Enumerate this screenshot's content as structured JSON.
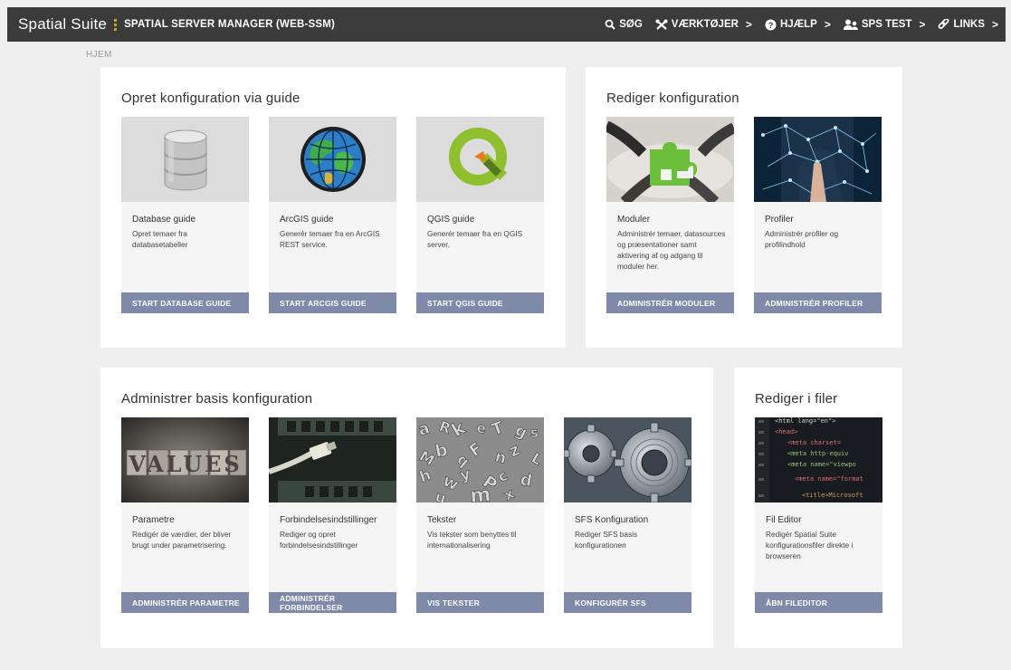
{
  "header": {
    "brand_name": "Spatial Suite",
    "brand_sub": "SPATIAL SERVER MANAGER (WEB-SSM)",
    "nav": [
      {
        "label": "SØG",
        "icon": "search-icon"
      },
      {
        "label": "VÆRKTØJER",
        "icon": "tools-icon"
      },
      {
        "label": "HJÆLP",
        "icon": "help-icon"
      },
      {
        "label": "SPS TEST",
        "icon": "users-icon"
      },
      {
        "label": "LINKS",
        "icon": "link-icon"
      }
    ],
    "caret": ">"
  },
  "breadcrumb": "HJEM",
  "panels": [
    {
      "title": "Opret konfiguration via guide",
      "cards": [
        {
          "title": "Database guide",
          "desc": "Opret temaer fra databasetabeller",
          "button": "START DATABASE GUIDE",
          "image": "database-image"
        },
        {
          "title": "ArcGIS guide",
          "desc": "Generér temaer fra en ArcGIS REST service.",
          "button": "START ARCGIS GUIDE",
          "image": "arcgis-globe-image"
        },
        {
          "title": "QGIS guide",
          "desc": "Generér temaer fra en QGIS server.",
          "button": "START QGIS GUIDE",
          "image": "qgis-logo-image"
        }
      ]
    },
    {
      "title": "Rediger konfiguration",
      "cards": [
        {
          "title": "Moduler",
          "desc": "Administrér temaer, datasources og præsentationer samt aktivering af og adgang til moduler her.",
          "button": "ADMINISTRÉR MODULER",
          "image": "puzzle-image"
        },
        {
          "title": "Profiler",
          "desc": "Administrér profiler og profilindhold",
          "button": "ADMINISTRÉR PROFILER",
          "image": "network-touch-image"
        }
      ]
    },
    {
      "title": "Administrer basis konfiguration",
      "cards": [
        {
          "title": "Parametre",
          "desc": "Redigér de værdier, der bliver brugt under parametrisering.",
          "button": "ADMINISTRÉR PARAMETRE",
          "image": "values-image"
        },
        {
          "title": "Forbindelsesindstillinger",
          "desc": "Rediger og opret forbindelsesindstillinger",
          "button": "ADMINISTRÉR FORBINDELSER",
          "image": "network-cable-image"
        },
        {
          "title": "Tekster",
          "desc": "Vis tekster som benyttes til internationalisering",
          "button": "VIS TEKSTER",
          "image": "letters-image"
        },
        {
          "title": "SFS Konfiguration",
          "desc": "Rediger SFS basis konfigurationen",
          "button": "KONFIGURÉR SFS",
          "image": "gears-image"
        }
      ]
    },
    {
      "title": "Rediger i filer",
      "cards": [
        {
          "title": "Fil Editor",
          "desc": "Redigér Spatial Suite konfigurationsfiler direkte i browseren",
          "button": "ÅBN FILEDITOR",
          "image": "code-editor-image"
        }
      ]
    }
  ],
  "image_text": {
    "values": "VALUES",
    "code_lines": [
      "<html lang=\"en\">",
      "<head>",
      "<meta charset=",
      "<meta http-equiv",
      "<meta name=\"viewpo",
      "<meta name=\"format",
      "<title>Microsoft"
    ]
  },
  "colors": {
    "topbar": "#3b3b3b",
    "brand_accent": "#c9a31a",
    "button": "#7e8aa8",
    "page_bg": "#efefef"
  }
}
